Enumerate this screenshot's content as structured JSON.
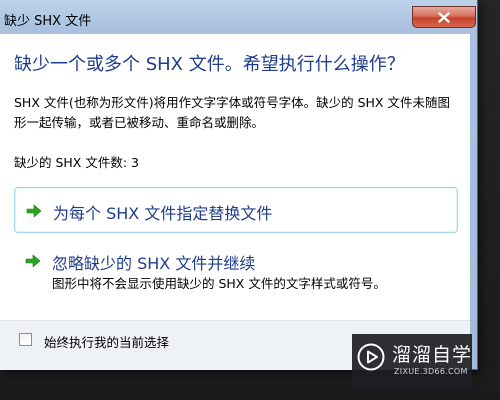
{
  "window": {
    "title": "缺少 SHX 文件"
  },
  "dialog": {
    "heading": "缺少一个或多个 SHX 文件。希望执行什么操作？",
    "description": "SHX 文件(也称为形文件)将用作文字字体或符号字体。缺少的 SHX 文件未随图形一起传输，或者已被移动、重命名或删除。",
    "missing_count_label": "缺少的 SHX 文件数: 3"
  },
  "options": [
    {
      "title": "为每个 SHX 文件指定替换文件",
      "subtitle": ""
    },
    {
      "title": "忽略缺少的 SHX 文件并继续",
      "subtitle": "图形中将不会显示使用缺少的 SHX 文件的文字样式或符号。"
    }
  ],
  "footer": {
    "checkbox_label": "始终执行我的当前选择",
    "checked": false
  },
  "watermark": {
    "name": "溜溜自学",
    "url": "ZIXUE.3D66.COM"
  },
  "icons": {
    "close": "close-icon",
    "option_arrow": "green-arrow-icon",
    "watermark_logo": "play-logo-icon"
  },
  "colors": {
    "heading": "#1f3d8c",
    "arrow": "#2aa520",
    "close_button": "#c5402a",
    "option_border": "#9fd6ec"
  }
}
